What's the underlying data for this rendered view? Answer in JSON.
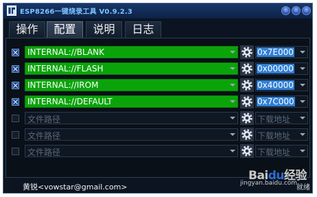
{
  "window": {
    "title": "ESP8266一键烧录工具 V0.9.2.3"
  },
  "tabs": [
    {
      "label": "操作",
      "active": false
    },
    {
      "label": "配置",
      "active": true
    },
    {
      "label": "说明",
      "active": false
    },
    {
      "label": "日志",
      "active": false
    }
  ],
  "rows": [
    {
      "checked": true,
      "path": "INTERNAL://BLANK",
      "address": "0x7E000"
    },
    {
      "checked": true,
      "path": "INTERNAL://FLASH",
      "address": "0x00000"
    },
    {
      "checked": true,
      "path": "INTERNAL://IROM",
      "address": "0x40000"
    },
    {
      "checked": true,
      "path": "INTERNAL://DEFAULT",
      "address": "0x7C000"
    },
    {
      "checked": false,
      "path_placeholder": "文件路径",
      "address_placeholder": "下载地址"
    },
    {
      "checked": false,
      "path_placeholder": "文件路径",
      "address_placeholder": "下载地址"
    },
    {
      "checked": false,
      "path_placeholder": "文件路径",
      "address_placeholder": "下载地址"
    }
  ],
  "status": {
    "author": "黄锐<vowstar@gmail.com>"
  },
  "watermark": {
    "logo_a": "Bai",
    "logo_b": "du",
    "logo_c": "经验",
    "url": "jingyan.baidu.com",
    "extra": "就绪"
  },
  "colors": {
    "path_green": "#0aa40a",
    "address_selected": "#2f7fd6",
    "background": "#0b1420",
    "title_text": "#7fc2ff"
  },
  "icons": {
    "settings": "gear-icon",
    "dropdown": "chevron-down-icon",
    "app": "app-icon"
  }
}
